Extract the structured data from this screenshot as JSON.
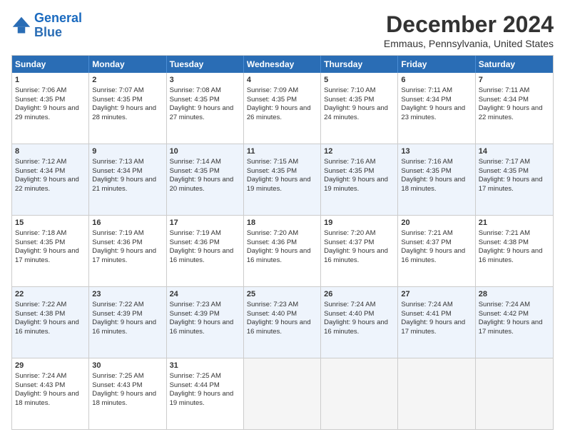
{
  "logo": {
    "line1": "General",
    "line2": "Blue"
  },
  "title": "December 2024",
  "subtitle": "Emmaus, Pennsylvania, United States",
  "days": [
    "Sunday",
    "Monday",
    "Tuesday",
    "Wednesday",
    "Thursday",
    "Friday",
    "Saturday"
  ],
  "weeks": [
    [
      {
        "day": "1",
        "sunrise": "Sunrise: 7:06 AM",
        "sunset": "Sunset: 4:35 PM",
        "daylight": "Daylight: 9 hours and 29 minutes."
      },
      {
        "day": "2",
        "sunrise": "Sunrise: 7:07 AM",
        "sunset": "Sunset: 4:35 PM",
        "daylight": "Daylight: 9 hours and 28 minutes."
      },
      {
        "day": "3",
        "sunrise": "Sunrise: 7:08 AM",
        "sunset": "Sunset: 4:35 PM",
        "daylight": "Daylight: 9 hours and 27 minutes."
      },
      {
        "day": "4",
        "sunrise": "Sunrise: 7:09 AM",
        "sunset": "Sunset: 4:35 PM",
        "daylight": "Daylight: 9 hours and 26 minutes."
      },
      {
        "day": "5",
        "sunrise": "Sunrise: 7:10 AM",
        "sunset": "Sunset: 4:35 PM",
        "daylight": "Daylight: 9 hours and 24 minutes."
      },
      {
        "day": "6",
        "sunrise": "Sunrise: 7:11 AM",
        "sunset": "Sunset: 4:34 PM",
        "daylight": "Daylight: 9 hours and 23 minutes."
      },
      {
        "day": "7",
        "sunrise": "Sunrise: 7:11 AM",
        "sunset": "Sunset: 4:34 PM",
        "daylight": "Daylight: 9 hours and 22 minutes."
      }
    ],
    [
      {
        "day": "8",
        "sunrise": "Sunrise: 7:12 AM",
        "sunset": "Sunset: 4:34 PM",
        "daylight": "Daylight: 9 hours and 22 minutes."
      },
      {
        "day": "9",
        "sunrise": "Sunrise: 7:13 AM",
        "sunset": "Sunset: 4:34 PM",
        "daylight": "Daylight: 9 hours and 21 minutes."
      },
      {
        "day": "10",
        "sunrise": "Sunrise: 7:14 AM",
        "sunset": "Sunset: 4:35 PM",
        "daylight": "Daylight: 9 hours and 20 minutes."
      },
      {
        "day": "11",
        "sunrise": "Sunrise: 7:15 AM",
        "sunset": "Sunset: 4:35 PM",
        "daylight": "Daylight: 9 hours and 19 minutes."
      },
      {
        "day": "12",
        "sunrise": "Sunrise: 7:16 AM",
        "sunset": "Sunset: 4:35 PM",
        "daylight": "Daylight: 9 hours and 19 minutes."
      },
      {
        "day": "13",
        "sunrise": "Sunrise: 7:16 AM",
        "sunset": "Sunset: 4:35 PM",
        "daylight": "Daylight: 9 hours and 18 minutes."
      },
      {
        "day": "14",
        "sunrise": "Sunrise: 7:17 AM",
        "sunset": "Sunset: 4:35 PM",
        "daylight": "Daylight: 9 hours and 17 minutes."
      }
    ],
    [
      {
        "day": "15",
        "sunrise": "Sunrise: 7:18 AM",
        "sunset": "Sunset: 4:35 PM",
        "daylight": "Daylight: 9 hours and 17 minutes."
      },
      {
        "day": "16",
        "sunrise": "Sunrise: 7:19 AM",
        "sunset": "Sunset: 4:36 PM",
        "daylight": "Daylight: 9 hours and 17 minutes."
      },
      {
        "day": "17",
        "sunrise": "Sunrise: 7:19 AM",
        "sunset": "Sunset: 4:36 PM",
        "daylight": "Daylight: 9 hours and 16 minutes."
      },
      {
        "day": "18",
        "sunrise": "Sunrise: 7:20 AM",
        "sunset": "Sunset: 4:36 PM",
        "daylight": "Daylight: 9 hours and 16 minutes."
      },
      {
        "day": "19",
        "sunrise": "Sunrise: 7:20 AM",
        "sunset": "Sunset: 4:37 PM",
        "daylight": "Daylight: 9 hours and 16 minutes."
      },
      {
        "day": "20",
        "sunrise": "Sunrise: 7:21 AM",
        "sunset": "Sunset: 4:37 PM",
        "daylight": "Daylight: 9 hours and 16 minutes."
      },
      {
        "day": "21",
        "sunrise": "Sunrise: 7:21 AM",
        "sunset": "Sunset: 4:38 PM",
        "daylight": "Daylight: 9 hours and 16 minutes."
      }
    ],
    [
      {
        "day": "22",
        "sunrise": "Sunrise: 7:22 AM",
        "sunset": "Sunset: 4:38 PM",
        "daylight": "Daylight: 9 hours and 16 minutes."
      },
      {
        "day": "23",
        "sunrise": "Sunrise: 7:22 AM",
        "sunset": "Sunset: 4:39 PM",
        "daylight": "Daylight: 9 hours and 16 minutes."
      },
      {
        "day": "24",
        "sunrise": "Sunrise: 7:23 AM",
        "sunset": "Sunset: 4:39 PM",
        "daylight": "Daylight: 9 hours and 16 minutes."
      },
      {
        "day": "25",
        "sunrise": "Sunrise: 7:23 AM",
        "sunset": "Sunset: 4:40 PM",
        "daylight": "Daylight: 9 hours and 16 minutes."
      },
      {
        "day": "26",
        "sunrise": "Sunrise: 7:24 AM",
        "sunset": "Sunset: 4:40 PM",
        "daylight": "Daylight: 9 hours and 16 minutes."
      },
      {
        "day": "27",
        "sunrise": "Sunrise: 7:24 AM",
        "sunset": "Sunset: 4:41 PM",
        "daylight": "Daylight: 9 hours and 17 minutes."
      },
      {
        "day": "28",
        "sunrise": "Sunrise: 7:24 AM",
        "sunset": "Sunset: 4:42 PM",
        "daylight": "Daylight: 9 hours and 17 minutes."
      }
    ],
    [
      {
        "day": "29",
        "sunrise": "Sunrise: 7:24 AM",
        "sunset": "Sunset: 4:43 PM",
        "daylight": "Daylight: 9 hours and 18 minutes."
      },
      {
        "day": "30",
        "sunrise": "Sunrise: 7:25 AM",
        "sunset": "Sunset: 4:43 PM",
        "daylight": "Daylight: 9 hours and 18 minutes."
      },
      {
        "day": "31",
        "sunrise": "Sunrise: 7:25 AM",
        "sunset": "Sunset: 4:44 PM",
        "daylight": "Daylight: 9 hours and 19 minutes."
      },
      null,
      null,
      null,
      null
    ]
  ]
}
